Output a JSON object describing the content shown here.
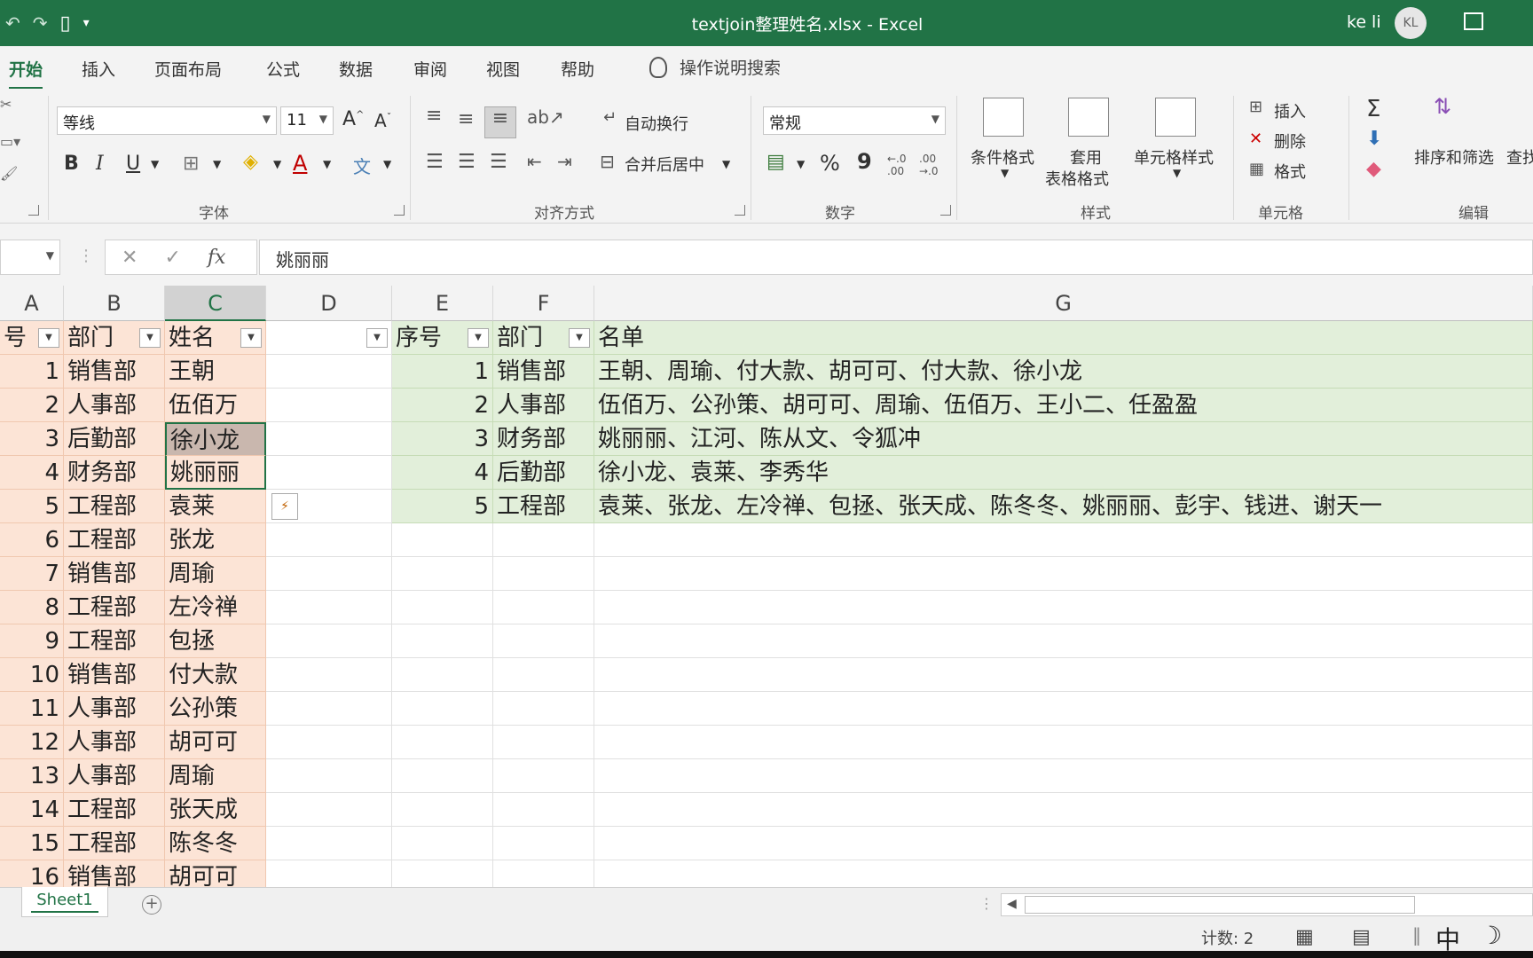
{
  "titlebar": {
    "title": "textjoin整理姓名.xlsx  -  Excel",
    "user": "ke li",
    "avatar": "KL"
  },
  "tabs": [
    "开始",
    "插入",
    "页面布局",
    "公式",
    "数据",
    "审阅",
    "视图",
    "帮助"
  ],
  "tell_me": "操作说明搜索",
  "ribbon": {
    "font_name": "等线",
    "font_size": "11",
    "wrap_text": "自动换行",
    "merge_center": "合并后居中",
    "number_format": "常规",
    "percent": "%",
    "comma": "9",
    "cond_format": "条件格式",
    "table_format_1": "套用",
    "table_format_2": "表格格式",
    "cell_styles": "单元格样式",
    "insert": "插入",
    "delete": "删除",
    "format": "格式",
    "sort_filter": "排序和筛选",
    "find": "查找",
    "groups": {
      "font": "字体",
      "alignment": "对齐方式",
      "number": "数字",
      "styles": "样式",
      "cells": "单元格",
      "editing": "编辑"
    }
  },
  "formula_bar": {
    "fx": "fx",
    "value": "姚丽丽"
  },
  "columns": [
    "A",
    "B",
    "C",
    "D",
    "E",
    "F",
    "G"
  ],
  "left_table": {
    "headers": [
      "号",
      "部门",
      "姓名"
    ],
    "rows": [
      [
        "1",
        "销售部",
        "王朝"
      ],
      [
        "2",
        "人事部",
        "伍佰万"
      ],
      [
        "3",
        "后勤部",
        "徐小龙"
      ],
      [
        "4",
        "财务部",
        "姚丽丽"
      ],
      [
        "5",
        "工程部",
        "袁莱"
      ],
      [
        "6",
        "工程部",
        "张龙"
      ],
      [
        "7",
        "销售部",
        "周瑜"
      ],
      [
        "8",
        "工程部",
        "左冷禅"
      ],
      [
        "9",
        "工程部",
        "包拯"
      ],
      [
        "10",
        "销售部",
        "付大款"
      ],
      [
        "11",
        "人事部",
        "公孙策"
      ],
      [
        "12",
        "人事部",
        "胡可可"
      ],
      [
        "13",
        "人事部",
        "周瑜"
      ],
      [
        "14",
        "工程部",
        "张天成"
      ],
      [
        "15",
        "工程部",
        "陈冬冬"
      ],
      [
        "16",
        "销售部",
        "胡可可"
      ]
    ]
  },
  "right_table": {
    "headers": [
      "序号",
      "部门",
      "名单"
    ],
    "rows": [
      [
        "1",
        "销售部",
        "王朝、周瑜、付大款、胡可可、付大款、徐小龙"
      ],
      [
        "2",
        "人事部",
        "伍佰万、公孙策、胡可可、周瑜、伍佰万、王小二、任盈盈"
      ],
      [
        "3",
        "财务部",
        "姚丽丽、江河、陈从文、令狐冲"
      ],
      [
        "4",
        "后勤部",
        "徐小龙、袁莱、李秀华"
      ],
      [
        "5",
        "工程部",
        "袁莱、张龙、左冷禅、包拯、张天成、陈冬冬、姚丽丽、彭宇、钱进、谢天一"
      ]
    ]
  },
  "sheet_tab": "Sheet1",
  "status": {
    "count": "计数: 2",
    "ime": "中"
  }
}
